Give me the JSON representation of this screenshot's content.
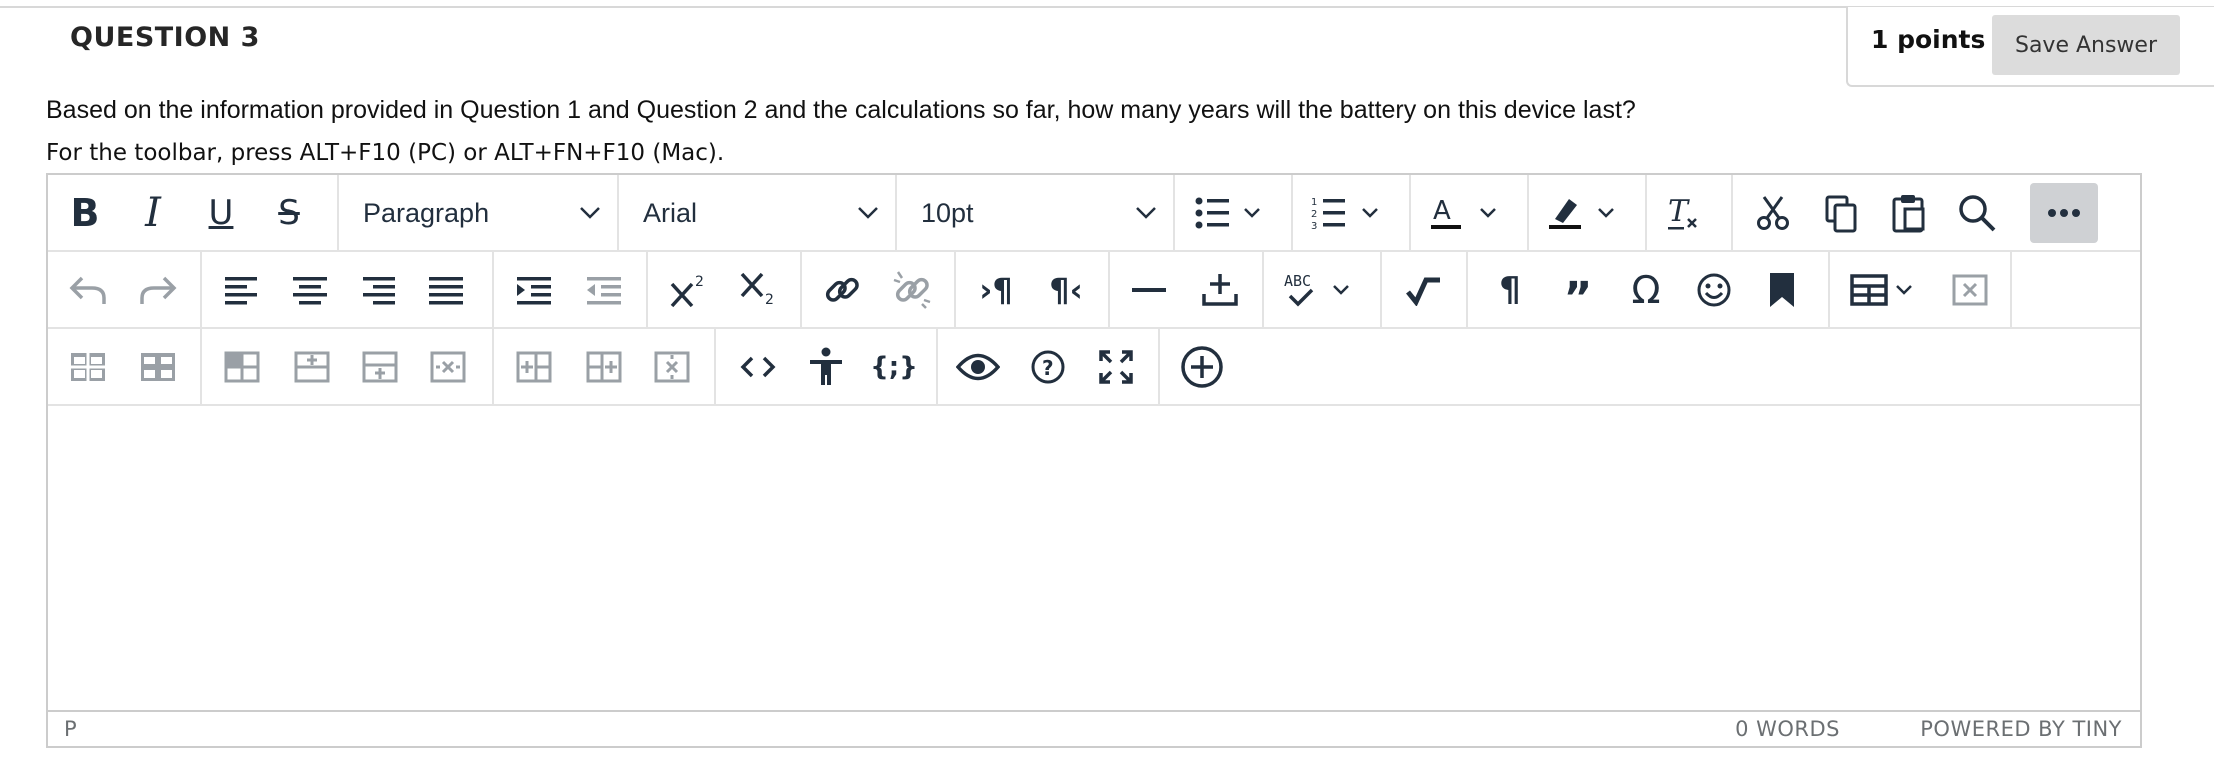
{
  "question": {
    "title": "QUESTION 3",
    "points": "1 points",
    "save_label": "Save Answer",
    "text": "Based on the information provided in Question 1 and Question 2 and the calculations so far, how many years will the battery on this device last?",
    "toolbar_help": "For the toolbar, press ALT+F10 (PC) or ALT+FN+F10 (Mac)."
  },
  "editor": {
    "block_format": "Paragraph",
    "font_family": "Arial",
    "font_size": "10pt",
    "content": "",
    "status_path": "P",
    "word_count": "0 WORDS",
    "powered_by": "POWERED BY TINY",
    "toolbar_icons": {
      "row1": [
        "bold-icon",
        "italic-icon",
        "underline-icon",
        "strikethrough-icon",
        "paragraph-select",
        "font-family-select",
        "font-size-select",
        "bullet-list-icon",
        "numbered-list-icon",
        "text-color-icon",
        "highlight-color-icon",
        "clear-formatting-icon",
        "cut-icon",
        "copy-icon",
        "paste-icon",
        "find-replace-icon",
        "more-icon"
      ],
      "row2": [
        "undo-icon",
        "redo-icon",
        "align-left-icon",
        "align-center-icon",
        "align-right-icon",
        "justify-icon",
        "indent-icon",
        "outdent-icon",
        "superscript-icon",
        "subscript-icon",
        "link-icon",
        "unlink-icon",
        "ltr-icon",
        "rtl-icon",
        "horizontal-rule-icon",
        "insert-attachment-icon",
        "spellcheck-icon",
        "math-icon",
        "paragraph-mark-icon",
        "blockquote-icon",
        "special-character-icon",
        "emoticon-icon",
        "bookmark-icon",
        "table-icon",
        "delete-table-icon"
      ],
      "row3": [
        "table-row-props-icon",
        "table-cell-props-icon",
        "merge-cells-icon",
        "insert-row-before-icon",
        "insert-row-after-icon",
        "delete-row-icon",
        "insert-col-before-icon",
        "insert-col-after-icon",
        "delete-col-icon",
        "source-code-icon",
        "accessibility-icon",
        "template-icon",
        "preview-icon",
        "help-icon",
        "fullscreen-icon",
        "add-content-icon"
      ]
    }
  }
}
